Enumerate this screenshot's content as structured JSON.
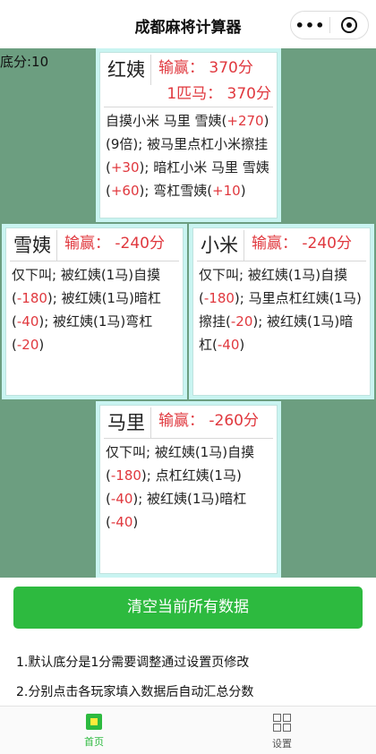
{
  "nav": {
    "title": "成都麻将计算器"
  },
  "base_score": "底分:10",
  "players": {
    "top": {
      "name": "红姨",
      "score": "输赢： 370分",
      "horse": "1匹马： 370分",
      "log": [
        {
          "t": "自摸小米 马里 雪姨("
        },
        {
          "n": "+270"
        },
        {
          "t": ")(9倍); 被马里点杠小米擦挂("
        },
        {
          "n": "+30"
        },
        {
          "t": "); 暗杠小米 马里 雪姨("
        },
        {
          "n": "+60"
        },
        {
          "t": "); 弯杠雪姨("
        },
        {
          "n": "+10"
        },
        {
          "t": ")"
        }
      ]
    },
    "left": {
      "name": "雪姨",
      "score": "输赢： -240分",
      "log": [
        {
          "t": "仅下叫; 被红姨(1马)自摸("
        },
        {
          "n": "-180"
        },
        {
          "t": "); 被红姨(1马)暗杠("
        },
        {
          "n": "-40"
        },
        {
          "t": "); 被红姨(1马)弯杠("
        },
        {
          "n": "-20"
        },
        {
          "t": ")"
        }
      ]
    },
    "right": {
      "name": "小米",
      "score": "输赢： -240分",
      "log": [
        {
          "t": "仅下叫; 被红姨(1马)自摸("
        },
        {
          "n": "-180"
        },
        {
          "t": "); 马里点杠红姨(1马)擦挂("
        },
        {
          "n": "-20"
        },
        {
          "t": "); 被红姨(1马)暗杠("
        },
        {
          "n": "-40"
        },
        {
          "t": ")"
        }
      ]
    },
    "bottom": {
      "name": "马里",
      "score": "输赢： -260分",
      "log": [
        {
          "t": "仅下叫; 被红姨(1马)自摸("
        },
        {
          "n": "-180"
        },
        {
          "t": "); 点杠红姨(1马)("
        },
        {
          "n": "-40"
        },
        {
          "t": "); 被红姨(1马)暗杠("
        },
        {
          "n": "-40"
        },
        {
          "t": ")"
        }
      ]
    }
  },
  "clear_button": "清空当前所有数据",
  "tips": [
    "1.默认底分是1分需要调整通过设置页修改",
    "2.分别点击各玩家填入数据后自动汇总分数"
  ],
  "tabbar": {
    "home": "首页",
    "settings": "设置"
  },
  "colors": {
    "accent": "#2dba3f",
    "table": "#6c9e80",
    "loss_gain": "#e0383e",
    "card_border": "#c9f4f1"
  },
  "icons": {
    "home": "chip-icon",
    "settings": "grid-icon",
    "menu": "more-dots-icon",
    "close": "target-icon"
  }
}
